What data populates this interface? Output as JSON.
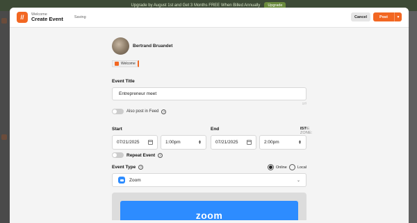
{
  "promo": {
    "text": "Upgrade by August 1st and Get 3 Months FREE When Billed Annually",
    "button": "Upgrade"
  },
  "header": {
    "subtitle": "Welcome",
    "title": "Create Event",
    "status": "Saving",
    "cancel_label": "Cancel",
    "post_label": "Post"
  },
  "author": {
    "name": "Bertrand Bruandet"
  },
  "group_tag": {
    "label": "Welcome"
  },
  "event_title": {
    "label": "Event Title",
    "value": "Entrepreneur meet",
    "counter": "17/"
  },
  "feed": {
    "label": "Also post in Feed"
  },
  "schedule": {
    "start_label": "Start",
    "end_label": "End",
    "timezone_label": "TIME ZONE:",
    "timezone_value": "IST",
    "start_date": "07/21/2025",
    "start_time": "1:00pm",
    "end_date": "07/21/2025",
    "end_time": "2:00pm"
  },
  "repeat": {
    "label": "Repeat Event"
  },
  "event_type": {
    "label": "Event Type",
    "option_online": "Online",
    "option_local": "Local",
    "selected": "online",
    "platform": "Zoom"
  },
  "zoom_banner": {
    "text": "zoom"
  },
  "colors": {
    "accent": "#f26722",
    "zoom_blue": "#2d8cff"
  }
}
